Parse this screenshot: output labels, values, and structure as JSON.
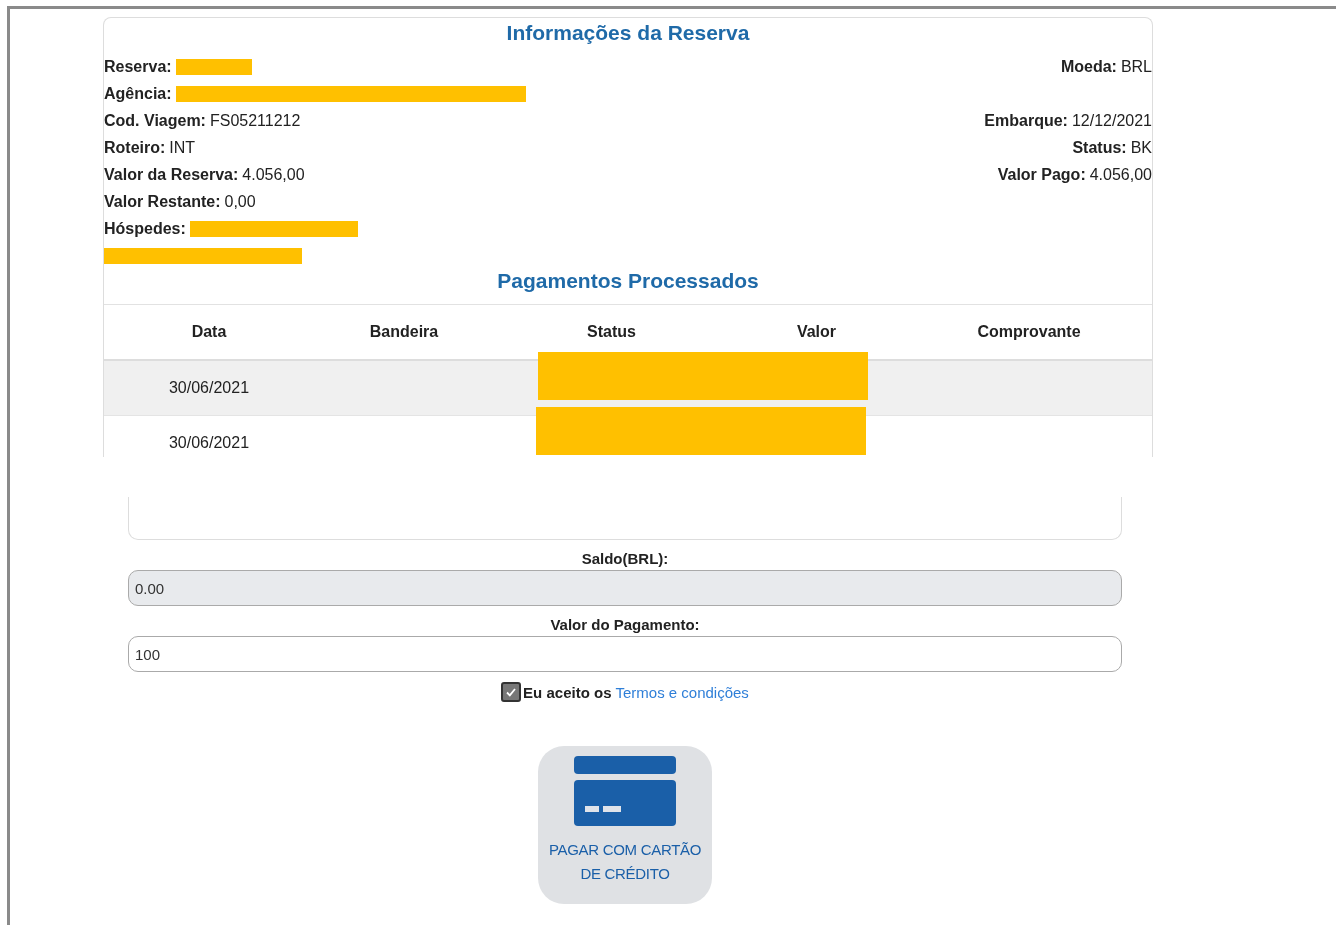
{
  "reservation": {
    "title": "Informações da Reserva",
    "rows": [
      {
        "left": {
          "label": "Reserva:",
          "redacted": true
        },
        "right": {
          "label": "Moeda:",
          "value": "BRL"
        }
      },
      {
        "left": {
          "label": "Agência:",
          "redacted": true
        }
      },
      {
        "left": {
          "label": "Cod. Viagem:",
          "value": "FS05211212",
          "redacted": false
        },
        "right": {
          "label": "Embarque:",
          "value": "12/12/2021"
        }
      },
      {
        "left": {
          "label": "Roteiro:",
          "value": "INT",
          "redacted": false
        },
        "right": {
          "label": "Status:",
          "value": "BK"
        }
      },
      {
        "left": {
          "label": "Valor da Reserva:",
          "value": "4.056,00",
          "redacted": false
        },
        "right": {
          "label": "Valor Pago:",
          "value": "4.056,00"
        }
      },
      {
        "left": {
          "label": "Valor Restante:",
          "value": "0,00",
          "redacted": false
        }
      },
      {
        "left": {
          "label": "Hóspedes:",
          "redacted": true
        }
      }
    ],
    "extra_line_redacted": true
  },
  "payments": {
    "title": "Pagamentos Processados",
    "columns": [
      "Data",
      "Bandeira",
      "Status",
      "Valor",
      "Comprovante"
    ],
    "rows": [
      {
        "date": "30/06/2021",
        "redacted": true
      },
      {
        "date": "30/06/2021",
        "redacted": true
      }
    ]
  },
  "form": {
    "balance_label": "Saldo(BRL):",
    "balance_value": "0.00",
    "balance_disabled": true,
    "amount_label": "Valor do Pagamento:",
    "amount_value": "100",
    "terms_checked": true,
    "terms_text": "Eu aceito os",
    "terms_link": "Termos e condições",
    "pay_button": "PAGAR COM CARTÃO DE CRÉDITO"
  }
}
